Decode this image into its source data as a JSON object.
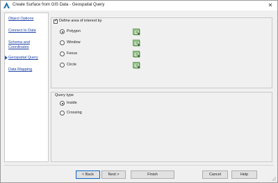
{
  "window": {
    "title": "Create Surface from GIS Data - Geospatial Query",
    "close_glyph": "✕"
  },
  "nav": {
    "items": [
      {
        "label": "Object Options"
      },
      {
        "label": "Connect to Data"
      },
      {
        "label": "Schema and"
      },
      {
        "label": "Coordinates"
      },
      {
        "label": "Geospatial Query",
        "current": true
      },
      {
        "label": "Data Mapping"
      }
    ]
  },
  "area": {
    "checkbox_label": "Define area of interest by",
    "checked": true,
    "options": [
      {
        "label": "Polygon",
        "selected": true
      },
      {
        "label": "Window",
        "selected": false
      },
      {
        "label": "Fence",
        "selected": false
      },
      {
        "label": "Circle",
        "selected": false
      }
    ]
  },
  "query": {
    "legend": "Query type",
    "options": [
      {
        "label": "Inside",
        "selected": true
      },
      {
        "label": "Crossing",
        "selected": false
      }
    ]
  },
  "buttons": {
    "back": "< Back",
    "next": "Next >",
    "finish": "Finish",
    "cancel": "Cancel",
    "help": "Help"
  },
  "colors": {
    "link": "#1a3fa6",
    "accent": "#1a5fb4",
    "pick_icon": "#3f8a2e"
  },
  "icons": {
    "app": "autocad-civil-logo-icon",
    "pick": "pick-in-drawing-icon",
    "current_step": "triangle-right-icon"
  }
}
